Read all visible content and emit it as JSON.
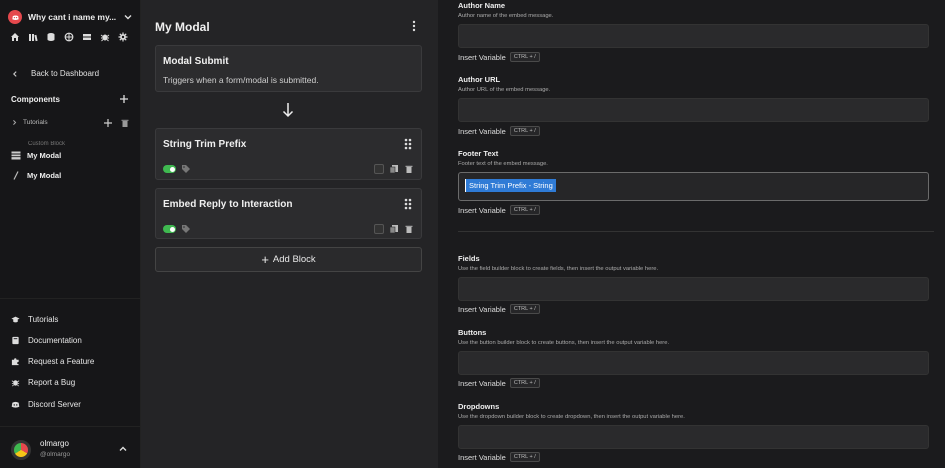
{
  "sidebar": {
    "server_name": "Why cant i name my...",
    "back_label": "Back to Dashboard",
    "components_title": "Components",
    "tree": [
      {
        "label": "Tutorials"
      },
      {
        "label": "Custom Block"
      }
    ],
    "items": [
      {
        "label": "My Modal",
        "icon": "table-icon"
      },
      {
        "label": "My Modal",
        "icon": "slash-icon"
      }
    ],
    "bottom_links": [
      {
        "label": "Tutorials",
        "icon": "graduation-cap-icon"
      },
      {
        "label": "Documentation",
        "icon": "book-icon"
      },
      {
        "label": "Request a Feature",
        "icon": "puzzle-icon"
      },
      {
        "label": "Report a Bug",
        "icon": "bug-icon"
      },
      {
        "label": "Discord Server",
        "icon": "discord-icon"
      }
    ],
    "user": {
      "name": "olmargo",
      "handle": "@olmargo"
    }
  },
  "middle": {
    "title": "My Modal",
    "trigger": {
      "title": "Modal Submit",
      "description": "Triggers when a form/modal is submitted."
    },
    "blocks": [
      {
        "title": "String Trim Prefix",
        "enabled": true
      },
      {
        "title": "Embed Reply to Interaction",
        "enabled": true
      }
    ],
    "add_block_label": "Add Block"
  },
  "right": {
    "insert_variable_label": "Insert Variable",
    "shortcut": "CTRL + /",
    "fields": [
      {
        "label": "Author Name",
        "description": "Author name of the embed message.",
        "value": ""
      },
      {
        "label": "Author URL",
        "description": "Author URL of the embed message.",
        "value": ""
      },
      {
        "label": "Footer Text",
        "description": "Footer text of the embed message.",
        "value": "String Trim Prefix - String"
      },
      {
        "label": "Fields",
        "description": "Use the field builder block to create fields, then insert the output variable here.",
        "value": ""
      },
      {
        "label": "Buttons",
        "description": "Use the button builder block to create buttons, then insert the output variable here.",
        "value": ""
      },
      {
        "label": "Dropdowns",
        "description": "Use the dropdown builder block to create dropdown, then insert the output variable here.",
        "value": ""
      }
    ]
  },
  "colors": {
    "accent_green": "#3fb950",
    "selection_blue": "#2f7bd6",
    "brand_red": "#e5484d"
  }
}
